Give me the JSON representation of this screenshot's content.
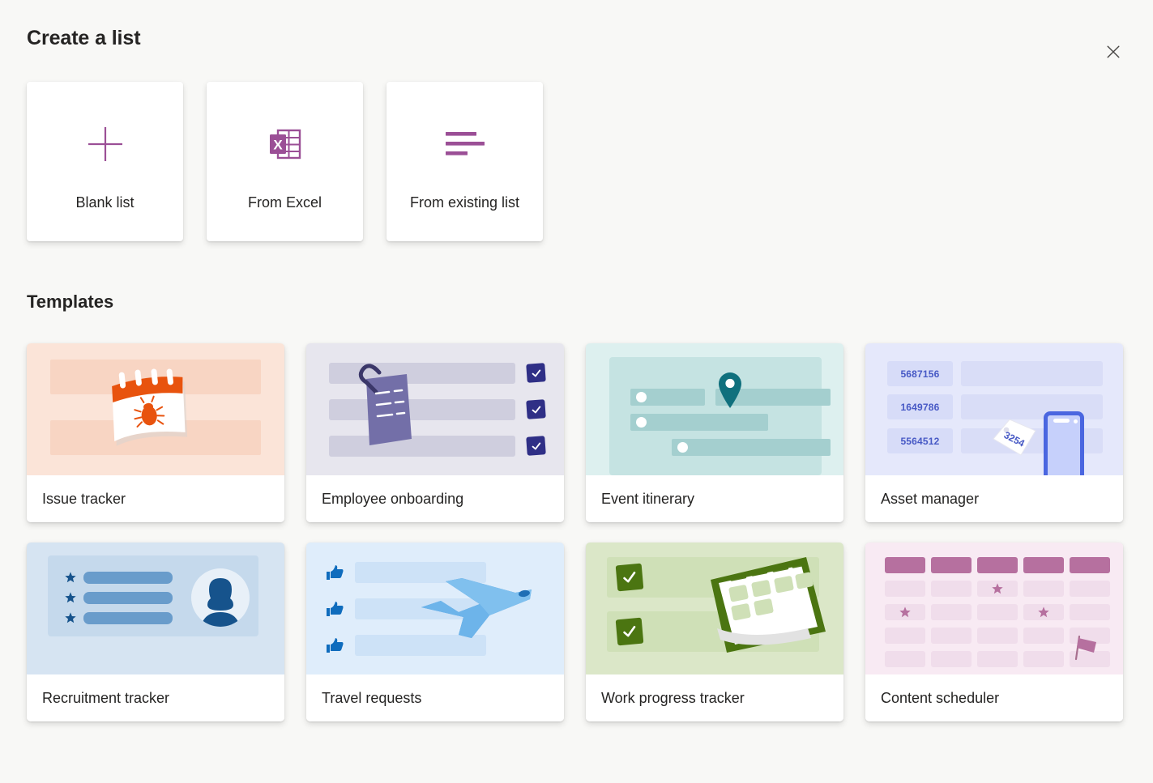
{
  "dialog": {
    "title": "Create a list",
    "close_label": "Close",
    "close_icon": "close-icon"
  },
  "create_options": [
    {
      "label": "Blank list",
      "icon": "plus-icon"
    },
    {
      "label": "From Excel",
      "icon": "excel-icon"
    },
    {
      "label": "From existing list",
      "icon": "list-lines-icon"
    }
  ],
  "templates_section": {
    "heading": "Templates"
  },
  "templates": [
    {
      "label": "Issue tracker",
      "icon": "calendar-bug-icon"
    },
    {
      "label": "Employee onboarding",
      "icon": "clipboard-checklist-icon"
    },
    {
      "label": "Event itinerary",
      "icon": "map-pin-icon"
    },
    {
      "label": "Asset manager",
      "icon": "phone-pricetag-icon"
    },
    {
      "label": "Recruitment tracker",
      "icon": "person-star-list-icon"
    },
    {
      "label": "Travel requests",
      "icon": "airplane-icon"
    },
    {
      "label": "Work progress tracker",
      "icon": "checkmark-calendar-icon"
    },
    {
      "label": "Content scheduler",
      "icon": "calendar-grid-star-icon"
    }
  ],
  "asset_manager_ids": {
    "row1": "5687156",
    "row2": "1649786",
    "row3": "5564512",
    "tag": "3254"
  },
  "colors": {
    "page_background": "#f8f8f6",
    "accent_purple": "#9b4f96",
    "text_primary": "#252423",
    "issue_tracker_bg": "#fbe4d8",
    "employee_onboarding_bg": "#e7e6ee",
    "event_itinerary_bg": "#ddf0ef",
    "asset_manager_bg": "#e5e8fb",
    "recruitment_tracker_bg": "#d6e4f2",
    "travel_requests_bg": "#dfedfb",
    "work_progress_bg": "#dbe7c8",
    "content_scheduler_bg": "#f8eaf3"
  }
}
